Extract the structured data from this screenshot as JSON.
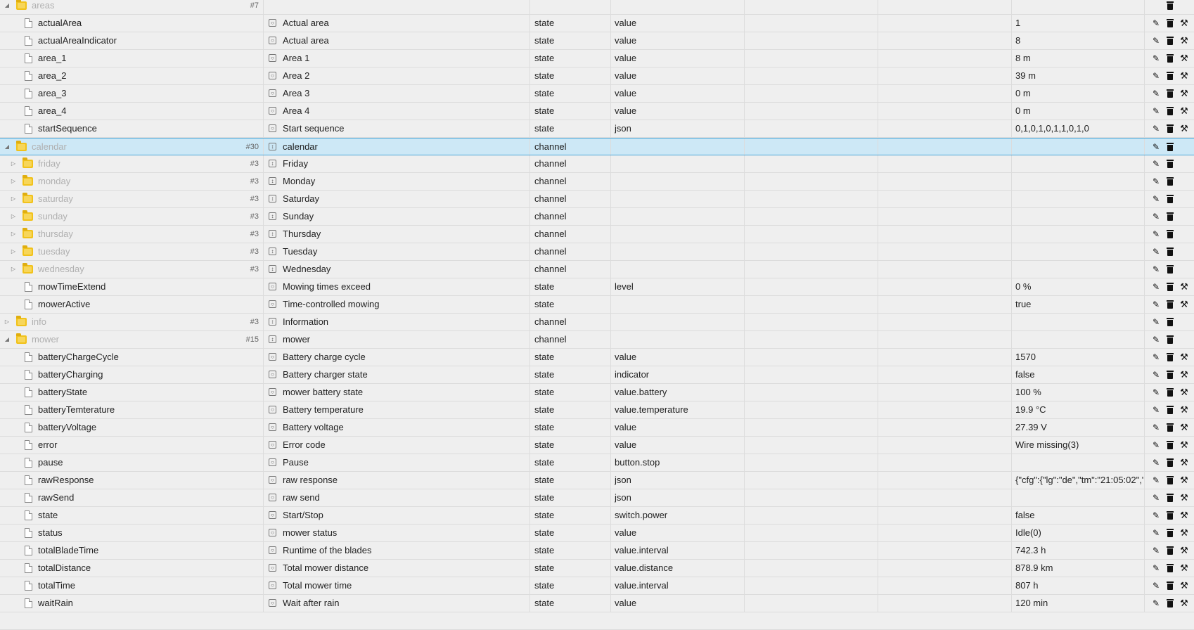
{
  "rows": [
    {
      "kind": "folder",
      "expanded": true,
      "level": 0,
      "id": "areas",
      "count": "#7",
      "name": "",
      "type": "",
      "role": "",
      "value": "",
      "actions": [
        "delete"
      ]
    },
    {
      "kind": "state",
      "level": 1,
      "id": "actualArea",
      "name": "Actual area",
      "type": "state",
      "role": "value",
      "value": "1",
      "actions": [
        "edit",
        "delete",
        "config"
      ]
    },
    {
      "kind": "state",
      "level": 1,
      "id": "actualAreaIndicator",
      "name": "Actual area",
      "type": "state",
      "role": "value",
      "value": "8",
      "actions": [
        "edit",
        "delete",
        "config"
      ]
    },
    {
      "kind": "state",
      "level": 1,
      "id": "area_1",
      "name": "Area 1",
      "type": "state",
      "role": "value",
      "value": "8 m",
      "actions": [
        "edit",
        "delete",
        "config"
      ]
    },
    {
      "kind": "state",
      "level": 1,
      "id": "area_2",
      "name": "Area 2",
      "type": "state",
      "role": "value",
      "value": "39 m",
      "actions": [
        "edit",
        "delete",
        "config"
      ]
    },
    {
      "kind": "state",
      "level": 1,
      "id": "area_3",
      "name": "Area 3",
      "type": "state",
      "role": "value",
      "value": "0 m",
      "actions": [
        "edit",
        "delete",
        "config"
      ]
    },
    {
      "kind": "state",
      "level": 1,
      "id": "area_4",
      "name": "Area 4",
      "type": "state",
      "role": "value",
      "value": "0 m",
      "actions": [
        "edit",
        "delete",
        "config"
      ]
    },
    {
      "kind": "state",
      "level": 1,
      "id": "startSequence",
      "name": "Start sequence",
      "type": "state",
      "role": "json",
      "value": "0,1,0,1,0,1,1,0,1,0",
      "actions": [
        "edit",
        "delete",
        "config"
      ]
    },
    {
      "kind": "folder",
      "expanded": true,
      "selected": true,
      "level": 0,
      "id": "calendar",
      "count": "#30",
      "name": "calendar",
      "type": "channel",
      "role": "",
      "value": "",
      "actions": [
        "edit",
        "delete"
      ]
    },
    {
      "kind": "folder",
      "expanded": false,
      "level": 1,
      "id": "friday",
      "count": "#3",
      "name": "Friday",
      "type": "channel",
      "role": "",
      "value": "",
      "actions": [
        "edit",
        "delete"
      ]
    },
    {
      "kind": "folder",
      "expanded": false,
      "level": 1,
      "id": "monday",
      "count": "#3",
      "name": "Monday",
      "type": "channel",
      "role": "",
      "value": "",
      "actions": [
        "edit",
        "delete"
      ]
    },
    {
      "kind": "folder",
      "expanded": false,
      "level": 1,
      "id": "saturday",
      "count": "#3",
      "name": "Saturday",
      "type": "channel",
      "role": "",
      "value": "",
      "actions": [
        "edit",
        "delete"
      ]
    },
    {
      "kind": "folder",
      "expanded": false,
      "level": 1,
      "id": "sunday",
      "count": "#3",
      "name": "Sunday",
      "type": "channel",
      "role": "",
      "value": "",
      "actions": [
        "edit",
        "delete"
      ]
    },
    {
      "kind": "folder",
      "expanded": false,
      "level": 1,
      "id": "thursday",
      "count": "#3",
      "name": "Thursday",
      "type": "channel",
      "role": "",
      "value": "",
      "actions": [
        "edit",
        "delete"
      ]
    },
    {
      "kind": "folder",
      "expanded": false,
      "level": 1,
      "id": "tuesday",
      "count": "#3",
      "name": "Tuesday",
      "type": "channel",
      "role": "",
      "value": "",
      "actions": [
        "edit",
        "delete"
      ]
    },
    {
      "kind": "folder",
      "expanded": false,
      "level": 1,
      "id": "wednesday",
      "count": "#3",
      "name": "Wednesday",
      "type": "channel",
      "role": "",
      "value": "",
      "actions": [
        "edit",
        "delete"
      ]
    },
    {
      "kind": "state",
      "level": 1,
      "id": "mowTimeExtend",
      "name": "Mowing times exceed",
      "type": "state",
      "role": "level",
      "value": "0 %",
      "actions": [
        "edit",
        "delete",
        "config"
      ]
    },
    {
      "kind": "state",
      "level": 1,
      "id": "mowerActive",
      "name": "Time-controlled mowing",
      "type": "state",
      "role": "",
      "value": "true",
      "actions": [
        "edit",
        "delete",
        "config"
      ]
    },
    {
      "kind": "folder",
      "expanded": false,
      "level": 0,
      "id": "info",
      "count": "#3",
      "name": "Information",
      "type": "channel",
      "role": "",
      "value": "",
      "actions": [
        "edit",
        "delete"
      ]
    },
    {
      "kind": "folder",
      "expanded": true,
      "level": 0,
      "id": "mower",
      "count": "#15",
      "name": "mower",
      "type": "channel",
      "role": "",
      "value": "",
      "actions": [
        "edit",
        "delete"
      ]
    },
    {
      "kind": "state",
      "level": 1,
      "id": "batteryChargeCycle",
      "name": "Battery charge cycle",
      "type": "state",
      "role": "value",
      "value": "1570",
      "actions": [
        "edit",
        "delete",
        "config"
      ]
    },
    {
      "kind": "state",
      "level": 1,
      "id": "batteryCharging",
      "name": "Battery charger state",
      "type": "state",
      "role": "indicator",
      "value": "false",
      "actions": [
        "edit",
        "delete",
        "config"
      ]
    },
    {
      "kind": "state",
      "level": 1,
      "id": "batteryState",
      "name": "mower battery state",
      "type": "state",
      "role": "value.battery",
      "value": "100 %",
      "actions": [
        "edit",
        "delete",
        "config"
      ]
    },
    {
      "kind": "state",
      "level": 1,
      "id": "batteryTemterature",
      "name": "Battery temperature",
      "type": "state",
      "role": "value.temperature",
      "value": "19.9 °C",
      "actions": [
        "edit",
        "delete",
        "config"
      ]
    },
    {
      "kind": "state",
      "level": 1,
      "id": "batteryVoltage",
      "name": "Battery voltage",
      "type": "state",
      "role": "value",
      "value": "27.39 V",
      "actions": [
        "edit",
        "delete",
        "config"
      ]
    },
    {
      "kind": "state",
      "level": 1,
      "id": "error",
      "name": "Error code",
      "type": "state",
      "role": "value",
      "value": "Wire missing(3)",
      "actions": [
        "edit",
        "delete",
        "config"
      ]
    },
    {
      "kind": "state",
      "level": 1,
      "id": "pause",
      "name": "Pause",
      "type": "state",
      "role": "button.stop",
      "value": "",
      "actions": [
        "edit",
        "delete",
        "config"
      ]
    },
    {
      "kind": "state",
      "level": 1,
      "id": "rawResponse",
      "name": "raw response",
      "type": "state",
      "role": "json",
      "value": "{\"cfg\":{\"lg\":\"de\",\"tm\":\"21:05:02\",\"",
      "actions": [
        "edit",
        "delete",
        "config"
      ]
    },
    {
      "kind": "state",
      "level": 1,
      "id": "rawSend",
      "name": "raw send",
      "type": "state",
      "role": "json",
      "value": "",
      "actions": [
        "edit",
        "delete",
        "config"
      ]
    },
    {
      "kind": "state",
      "level": 1,
      "id": "state",
      "name": "Start/Stop",
      "type": "state",
      "role": "switch.power",
      "value": "false",
      "actions": [
        "edit",
        "delete",
        "config"
      ]
    },
    {
      "kind": "state",
      "level": 1,
      "id": "status",
      "name": "mower status",
      "type": "state",
      "role": "value",
      "value": "Idle(0)",
      "actions": [
        "edit",
        "delete",
        "config"
      ]
    },
    {
      "kind": "state",
      "level": 1,
      "id": "totalBladeTime",
      "name": "Runtime of the blades",
      "type": "state",
      "role": "value.interval",
      "value": "742.3 h",
      "actions": [
        "edit",
        "delete",
        "config"
      ]
    },
    {
      "kind": "state",
      "level": 1,
      "id": "totalDistance",
      "name": "Total mower distance",
      "type": "state",
      "role": "value.distance",
      "value": "878.9 km",
      "actions": [
        "edit",
        "delete",
        "config"
      ]
    },
    {
      "kind": "state",
      "level": 1,
      "id": "totalTime",
      "name": "Total mower time",
      "type": "state",
      "role": "value.interval",
      "value": "807 h",
      "actions": [
        "edit",
        "delete",
        "config"
      ]
    },
    {
      "kind": "state",
      "level": 1,
      "id": "waitRain",
      "name": "Wait after rain",
      "type": "state",
      "role": "value",
      "value": "120 min",
      "actions": [
        "edit",
        "delete",
        "config"
      ]
    }
  ],
  "colors": {
    "background": "#efefef",
    "selected_row": "#cde8f6",
    "selected_border": "#4da6d8",
    "folder_icon": "#f1c21b",
    "dim_label": "#b0b0b0"
  },
  "icons": {
    "expanded": "triangle-down-icon",
    "collapsed": "triangle-right-icon",
    "folder": "folder-icon",
    "state": "file-icon",
    "edit": "pencil-icon",
    "delete": "trash-icon",
    "config": "wrench-icon"
  }
}
